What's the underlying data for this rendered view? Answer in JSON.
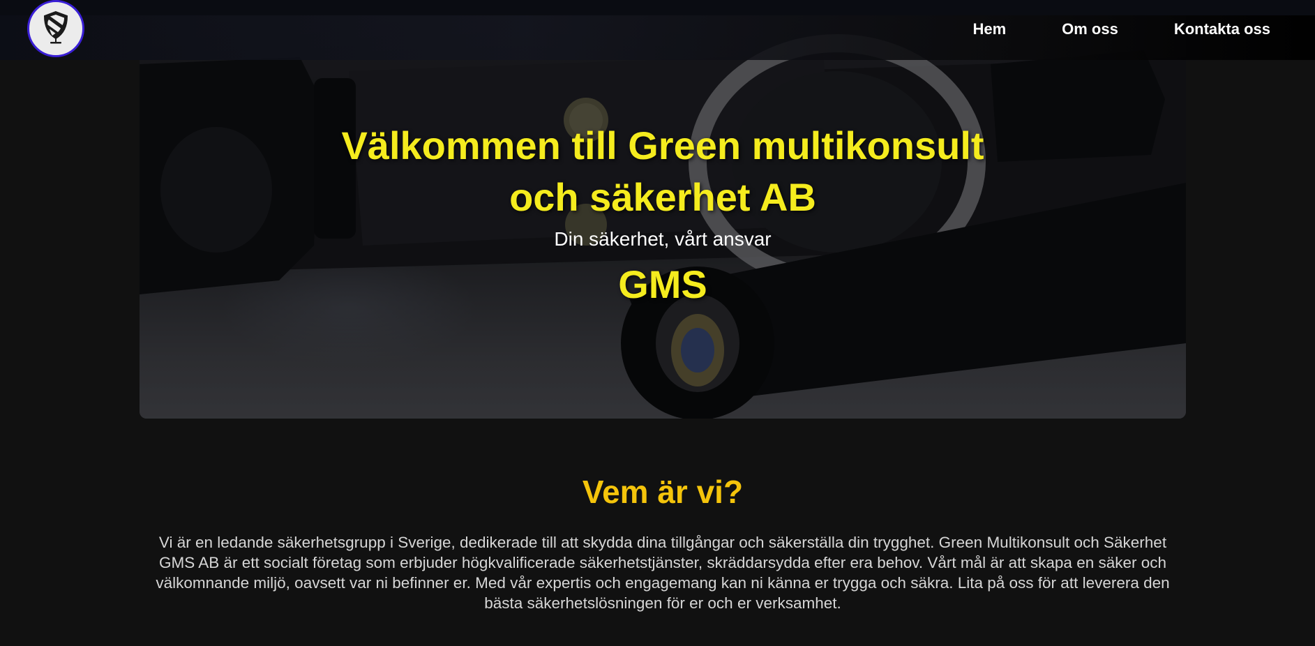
{
  "header": {
    "logo_icon": "shield-icon",
    "nav": [
      {
        "label": "Hem"
      },
      {
        "label": "Om oss"
      },
      {
        "label": "Kontakta oss"
      }
    ]
  },
  "hero": {
    "title_line1": "Välkommen till Green multikonsult",
    "title_line2": "och säkerhet AB",
    "subtitle": "Din säkerhet, vårt ansvar",
    "brand": "GMS"
  },
  "about": {
    "heading": "Vem är vi?",
    "body": "Vi är en ledande säkerhetsgrupp i Sverige, dedikerade till att skydda dina tillgångar och säkerställa din trygghet. Green Multikonsult och Säkerhet GMS AB är ett socialt företag som erbjuder högkvalificerade säkerhetstjänster, skräddarsydda efter era behov. Vårt mål är att skapa en säker och välkomnande miljö, oavsett var ni befinner er. Med vår expertis och engagemang kan ni känna er trygga och säkra. Lita på oss för att leverera den bästa säkerhetslösningen för er och er verksamhet."
  },
  "colors": {
    "background": "#111111",
    "hero_title": "#f5ec1e",
    "section_heading": "#f4c40b",
    "logo_border": "#3a1fd6"
  }
}
